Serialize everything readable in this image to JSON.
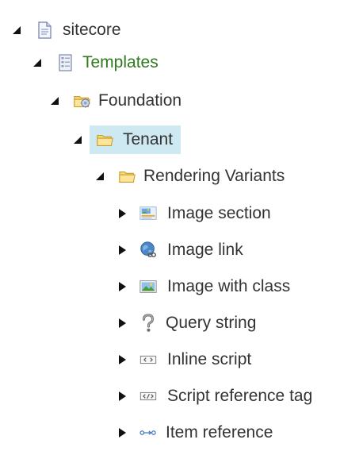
{
  "tree": {
    "items": [
      {
        "label": "sitecore",
        "icon": "document-icon",
        "expanded": true
      },
      {
        "label": "Templates",
        "icon": "template-list-icon",
        "expanded": true,
        "color": "#2f7a1f"
      },
      {
        "label": "Foundation",
        "icon": "folder-gear-icon",
        "expanded": true
      },
      {
        "label": "Tenant",
        "icon": "folder-icon",
        "expanded": true,
        "selected": true
      },
      {
        "label": "Rendering Variants",
        "icon": "folder-icon",
        "expanded": true
      },
      {
        "label": "Image section",
        "icon": "image-section-icon",
        "expanded": false
      },
      {
        "label": "Image link",
        "icon": "globe-link-icon",
        "expanded": false
      },
      {
        "label": "Image with class",
        "icon": "picture-icon",
        "expanded": false
      },
      {
        "label": "Query string",
        "icon": "question-mark-icon",
        "expanded": false
      },
      {
        "label": "Inline script",
        "icon": "inline-script-icon",
        "expanded": false
      },
      {
        "label": "Script reference tag",
        "icon": "script-tag-icon",
        "expanded": false
      },
      {
        "label": "Item reference",
        "icon": "item-reference-icon",
        "expanded": false
      }
    ]
  },
  "colors": {
    "selection": "#cfe9f3",
    "templates_text": "#2f7a1f",
    "text": "#333333"
  }
}
